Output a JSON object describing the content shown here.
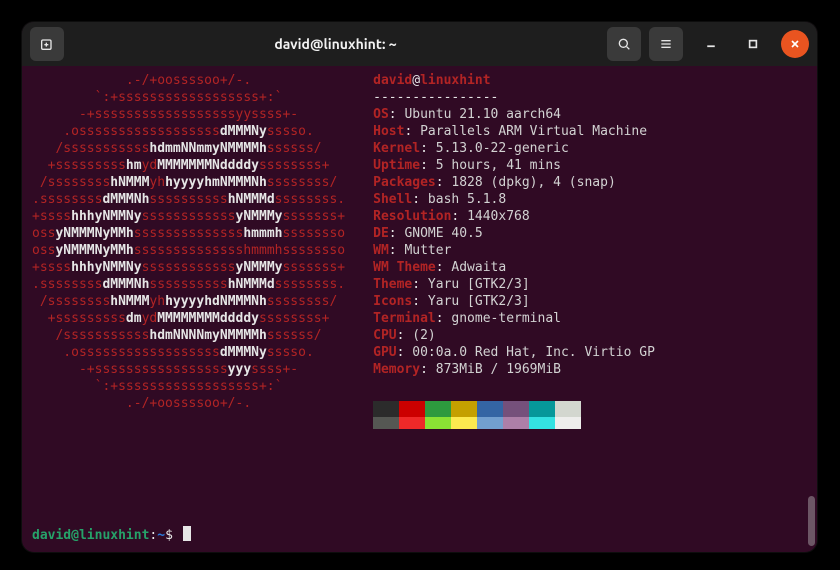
{
  "window": {
    "title": "david@linuxhint: ~"
  },
  "neofetch": {
    "user": "david",
    "host": "linuxhint",
    "dashes": "----------------",
    "info": [
      {
        "key": "OS",
        "value": "Ubuntu 21.10 aarch64"
      },
      {
        "key": "Host",
        "value": "Parallels ARM Virtual Machine"
      },
      {
        "key": "Kernel",
        "value": "5.13.0-22-generic"
      },
      {
        "key": "Uptime",
        "value": "5 hours, 41 mins"
      },
      {
        "key": "Packages",
        "value": "1828 (dpkg), 4 (snap)"
      },
      {
        "key": "Shell",
        "value": "bash 5.1.8"
      },
      {
        "key": "Resolution",
        "value": "1440x768"
      },
      {
        "key": "DE",
        "value": "GNOME 40.5"
      },
      {
        "key": "WM",
        "value": "Mutter"
      },
      {
        "key": "WM Theme",
        "value": "Adwaita"
      },
      {
        "key": "Theme",
        "value": "Yaru [GTK2/3]"
      },
      {
        "key": "Icons",
        "value": "Yaru [GTK2/3]"
      },
      {
        "key": "Terminal",
        "value": "gnome-terminal"
      },
      {
        "key": "CPU",
        "value": "(2)"
      },
      {
        "key": "GPU",
        "value": "00:0a.0 Red Hat, Inc. Virtio GP"
      },
      {
        "key": "Memory",
        "value": "873MiB / 1969MiB"
      }
    ],
    "palette": {
      "row1": [
        "#2b2b2b",
        "#cc0000",
        "#2d9a3e",
        "#c4a000",
        "#3465a4",
        "#75507b",
        "#06989a",
        "#d3d7cf"
      ],
      "row2": [
        "#555753",
        "#ef2929",
        "#8ae234",
        "#fce94f",
        "#729fcf",
        "#ad7fa8",
        "#34e2e2",
        "#eeeeec"
      ]
    },
    "logo": [
      [
        {
          "r": "            .-/+oossssoo+/-.            "
        }
      ],
      [
        {
          "r": "        `:+ssssssssssssssssss+:`        "
        }
      ],
      [
        {
          "r": "      -+ssssssssssssssssssyyssss+-      "
        }
      ],
      [
        {
          "r": "    .ossssssssssssssssss"
        },
        {
          "w": "dMMMNy"
        },
        {
          "r": "sssso.    "
        }
      ],
      [
        {
          "r": "   /sssssssssss"
        },
        {
          "w": "hdmmNNmmyNMMMMh"
        },
        {
          "r": "ssssss/   "
        }
      ],
      [
        {
          "r": "  +sssssssss"
        },
        {
          "w": "hm"
        },
        {
          "r": "yd"
        },
        {
          "w": "MMMMMMMNddddy"
        },
        {
          "r": "ssssssss+  "
        }
      ],
      [
        {
          "r": " /ssssssss"
        },
        {
          "w": "hNMMM"
        },
        {
          "r": "yh"
        },
        {
          "w": "hyyyyhmNMMMNh"
        },
        {
          "r": "ssssssss/ "
        }
      ],
      [
        {
          "r": ".ssssssss"
        },
        {
          "w": "dMMMNh"
        },
        {
          "r": "ssssssssss"
        },
        {
          "w": "hNMMMd"
        },
        {
          "r": "ssssssss."
        }
      ],
      [
        {
          "r": "+ssss"
        },
        {
          "w": "hhhyNMMNy"
        },
        {
          "r": "ssssssssssss"
        },
        {
          "w": "yNMMMy"
        },
        {
          "r": "sssssss+"
        }
      ],
      [
        {
          "r": "oss"
        },
        {
          "w": "yNMMMNyMMh"
        },
        {
          "r": "ssssssssssssss"
        },
        {
          "w": "hmmmh"
        },
        {
          "r": "ssssssso"
        }
      ],
      [
        {
          "r": "oss"
        },
        {
          "w": "yNMMMNyMMh"
        },
        {
          "r": "sssssssssssssshmmmhssssssso"
        }
      ],
      [
        {
          "r": "+ssss"
        },
        {
          "w": "hhhyNMMNy"
        },
        {
          "r": "ssssssssssss"
        },
        {
          "w": "yNMMMy"
        },
        {
          "r": "sssssss+"
        }
      ],
      [
        {
          "r": ".ssssssss"
        },
        {
          "w": "dMMMNh"
        },
        {
          "r": "ssssssssss"
        },
        {
          "w": "hNMMMd"
        },
        {
          "r": "ssssssss."
        }
      ],
      [
        {
          "r": " /ssssssss"
        },
        {
          "w": "hNMMM"
        },
        {
          "r": "yh"
        },
        {
          "w": "hyyyyhdNMMMNh"
        },
        {
          "r": "ssssssss/ "
        }
      ],
      [
        {
          "r": "  +sssssssss"
        },
        {
          "w": "dm"
        },
        {
          "r": "yd"
        },
        {
          "w": "MMMMMMMMddddy"
        },
        {
          "r": "ssssssss+  "
        }
      ],
      [
        {
          "r": "   /sssssssssss"
        },
        {
          "w": "hdmNNNNmyNMMMMh"
        },
        {
          "r": "ssssss/   "
        }
      ],
      [
        {
          "r": "    .ossssssssssssssssss"
        },
        {
          "w": "dMMMNy"
        },
        {
          "r": "sssso.    "
        }
      ],
      [
        {
          "r": "      -+sssssssssssssssss"
        },
        {
          "w": "yyy"
        },
        {
          "r": "ssss+-      "
        }
      ],
      [
        {
          "r": "        `:+ssssssssssssssssss+:`        "
        }
      ],
      [
        {
          "r": "            .-/+oossssoo+/-.            "
        }
      ]
    ]
  },
  "prompt": {
    "user": "david@linuxhint",
    "path": "~",
    "symbol": "$"
  }
}
